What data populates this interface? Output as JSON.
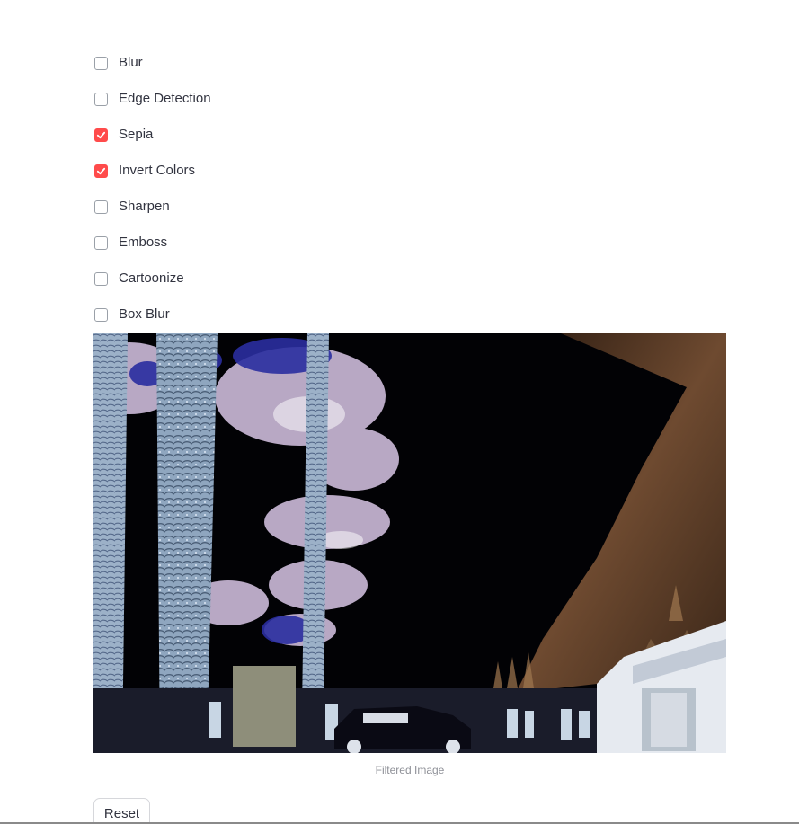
{
  "filters": [
    {
      "label": "Blur",
      "checked": false
    },
    {
      "label": "Edge Detection",
      "checked": false
    },
    {
      "label": "Sepia",
      "checked": true
    },
    {
      "label": "Invert Colors",
      "checked": true
    },
    {
      "label": "Sharpen",
      "checked": false
    },
    {
      "label": "Emboss",
      "checked": false
    },
    {
      "label": "Cartoonize",
      "checked": false
    },
    {
      "label": "Box Blur",
      "checked": false
    }
  ],
  "image": {
    "caption": "Filtered Image"
  },
  "reset_label": "Reset",
  "colors": {
    "accent": "#ff4b4b",
    "text": "#31333f",
    "caption": "#8e9097"
  }
}
